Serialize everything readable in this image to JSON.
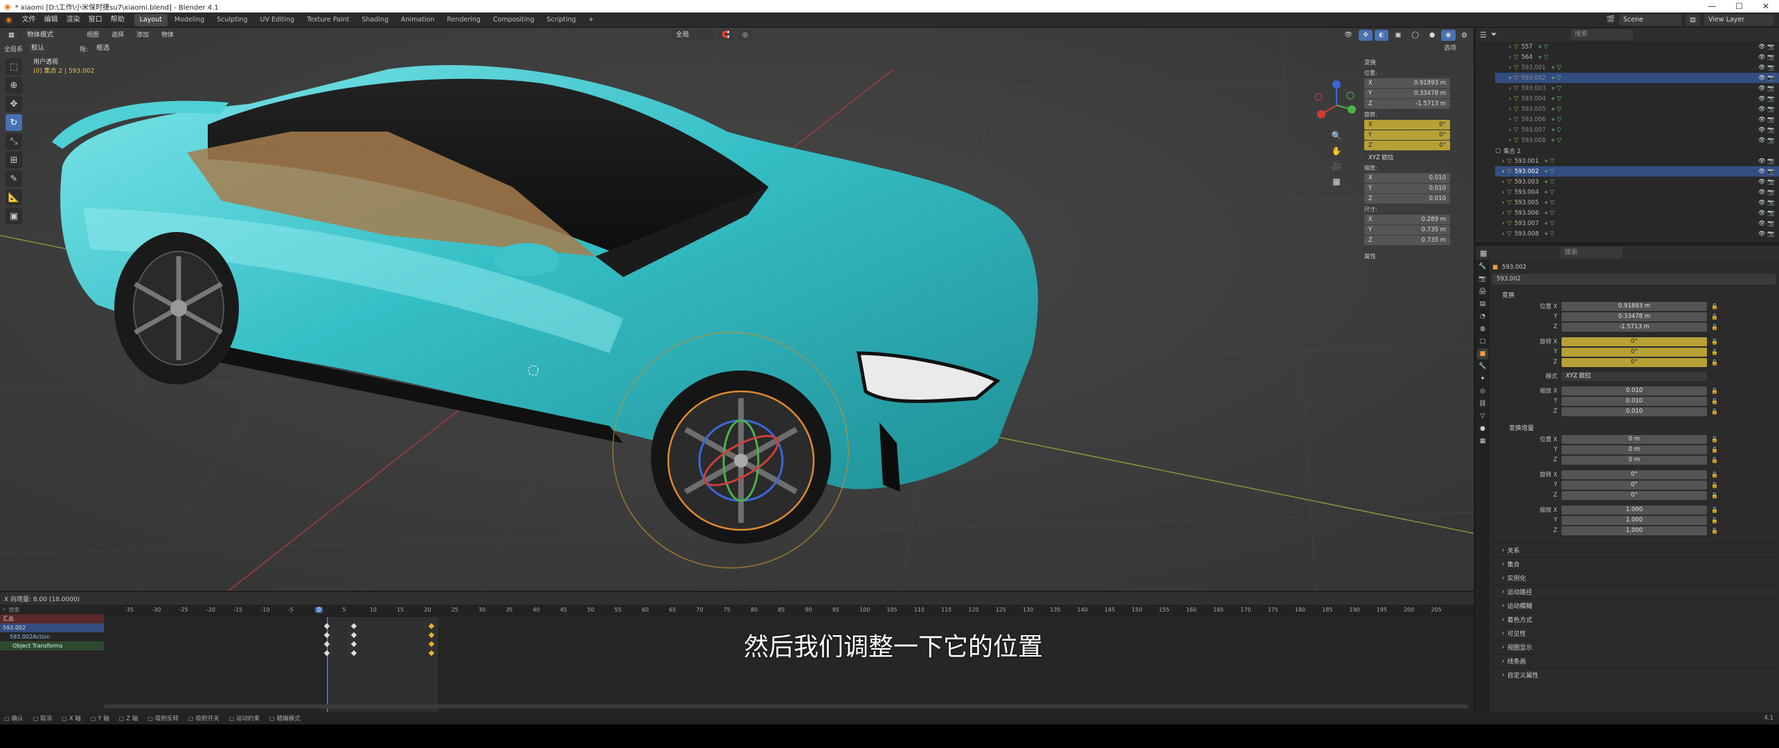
{
  "window": {
    "title": "* xiaomi [D:\\工作\\小米保时捷su7\\xiaomi.blend] - Blender 4.1",
    "controls": [
      "—",
      "☐",
      "✕"
    ]
  },
  "menubar": {
    "menus": [
      "文件",
      "编辑",
      "渲染",
      "窗口",
      "帮助"
    ],
    "workspaces": [
      "Layout",
      "Modeling",
      "Sculpting",
      "UV Editing",
      "Texture Paint",
      "Shading",
      "Animation",
      "Rendering",
      "Compositing",
      "Scripting"
    ],
    "active_workspace": "Layout",
    "add_tab": "+",
    "scene_label": "Scene",
    "view_layer_label": "View Layer"
  },
  "viewport_header": {
    "mode": "物体模式",
    "menus": [
      "视图",
      "选择",
      "添加",
      "物体"
    ],
    "orientation_label": "全局系",
    "orientation_value": "默认",
    "drag_label": "拖:",
    "drag_value": "框选",
    "transform_pivot": "全局",
    "options_label": "选项"
  },
  "viewport": {
    "view_name": "用户透视",
    "collection_info": "(0) 集合 2 | 593.002",
    "n_panel": {
      "section_transform": "变换",
      "location_label": "位置:",
      "location": [
        {
          "axis": "X",
          "value": "0.91893 m"
        },
        {
          "axis": "Y",
          "value": "0.33478 m"
        },
        {
          "axis": "Z",
          "value": "-1.5713 m"
        }
      ],
      "rotation_label": "旋转:",
      "rotation": [
        {
          "axis": "X",
          "value": "0°"
        },
        {
          "axis": "Y",
          "value": "0°"
        },
        {
          "axis": "Z",
          "value": "0°"
        }
      ],
      "rotation_mode": "XYZ 欧拉",
      "scale_label": "缩放:",
      "scale": [
        {
          "axis": "X",
          "value": "0.010"
        },
        {
          "axis": "Y",
          "value": "0.010"
        },
        {
          "axis": "Z",
          "value": "0.010"
        }
      ],
      "dimensions_label": "尺寸:",
      "dimensions": [
        {
          "axis": "X",
          "value": "0.289 m"
        },
        {
          "axis": "Y",
          "value": "0.735 m"
        },
        {
          "axis": "Z",
          "value": "0.735 m"
        }
      ],
      "section_properties": "属性"
    }
  },
  "outliner": {
    "search_placeholder": "搜索",
    "rows": [
      {
        "name": "557",
        "selected": false,
        "dim": false
      },
      {
        "name": "564",
        "selected": false,
        "dim": false
      },
      {
        "name": "593.001",
        "selected": false,
        "dim": true
      },
      {
        "name": "593.002",
        "selected": true,
        "dim": true
      },
      {
        "name": "593.003",
        "selected": false,
        "dim": true
      },
      {
        "name": "593.004",
        "selected": false,
        "dim": true
      },
      {
        "name": "593.005",
        "selected": false,
        "dim": true
      },
      {
        "name": "593.006",
        "selected": false,
        "dim": true
      },
      {
        "name": "593.007",
        "selected": false,
        "dim": true
      },
      {
        "name": "593.008",
        "selected": false,
        "dim": true
      }
    ],
    "collection2": "集合 2",
    "rows2": [
      {
        "name": "593.001",
        "selected": false
      },
      {
        "name": "593.002",
        "selected": true
      },
      {
        "name": "593.003",
        "selected": false
      },
      {
        "name": "593.004",
        "selected": false
      },
      {
        "name": "593.005",
        "selected": false
      },
      {
        "name": "593.006",
        "selected": false
      },
      {
        "name": "593.007",
        "selected": false
      },
      {
        "name": "593.008",
        "selected": false
      }
    ]
  },
  "properties": {
    "search_placeholder": "搜索",
    "object_breadcrumb": "593.002",
    "object_name": "593.002",
    "section_transform": "变换",
    "location": [
      {
        "label": "位置 X",
        "value": "0.91893 m"
      },
      {
        "label": "Y",
        "value": "0.33478 m"
      },
      {
        "label": "Z",
        "value": "-1.5713 m"
      }
    ],
    "rotation": [
      {
        "label": "旋转 X",
        "value": "0°"
      },
      {
        "label": "Y",
        "value": "0°"
      },
      {
        "label": "Z",
        "value": "0°"
      }
    ],
    "mode_label": "模式",
    "mode_value": "XYZ 欧拉",
    "scale": [
      {
        "label": "缩放 X",
        "value": "0.010"
      },
      {
        "label": "Y",
        "value": "0.010"
      },
      {
        "label": "Z",
        "value": "0.010"
      }
    ],
    "section_delta": "变换增量",
    "delta_location": [
      {
        "label": "位置 X",
        "value": "0 m"
      },
      {
        "label": "Y",
        "value": "0 m"
      },
      {
        "label": "Z",
        "value": "0 m"
      }
    ],
    "delta_rotation": [
      {
        "label": "旋转 X",
        "value": "0°"
      },
      {
        "label": "Y",
        "value": "0°"
      },
      {
        "label": "Z",
        "value": "0°"
      }
    ],
    "delta_scale": [
      {
        "label": "缩放 X",
        "value": "1.000"
      },
      {
        "label": "Y",
        "value": "1.000"
      },
      {
        "label": "Z",
        "value": "1.000"
      }
    ],
    "collapsed_sections": [
      "关系",
      "集合",
      "实例化",
      "运动路径",
      "运动模糊",
      "着色方式",
      "可见性",
      "视图显示",
      "线条画",
      "自定义属性"
    ]
  },
  "timeline": {
    "header_text": "X 向增量: 8.00 (18.0000)",
    "search_placeholder": "搜索",
    "channels": [
      "汇总",
      "593.002",
      "593.002Action",
      "Object Transforms"
    ],
    "ruler_ticks": [
      "-35",
      "-30",
      "-25",
      "-20",
      "-15",
      "-10",
      "-5",
      "0",
      "5",
      "10",
      "15",
      "20",
      "25",
      "30",
      "35",
      "40",
      "45",
      "50",
      "55",
      "60",
      "65",
      "70",
      "75",
      "80",
      "85",
      "90",
      "95",
      "100",
      "105",
      "110",
      "115",
      "120",
      "125",
      "130",
      "135",
      "140",
      "145",
      "150",
      "155",
      "160",
      "165",
      "170",
      "175",
      "180",
      "185",
      "190",
      "195",
      "200",
      "205"
    ],
    "current_frame": "0"
  },
  "statusbar": {
    "items": [
      "确认",
      "取消",
      "X 轴",
      "Y 轴",
      "Z 轴",
      "吸附反转",
      "吸附开关",
      "运动约束",
      "精确模式"
    ],
    "version": "4.1"
  },
  "subtitle": "然后我们调整一下它的位置",
  "colors": {
    "accent": "#4772b3",
    "selection": "#334d80",
    "keyframe_yellow": "#b7a136",
    "car_body": "#3fc3c8"
  }
}
